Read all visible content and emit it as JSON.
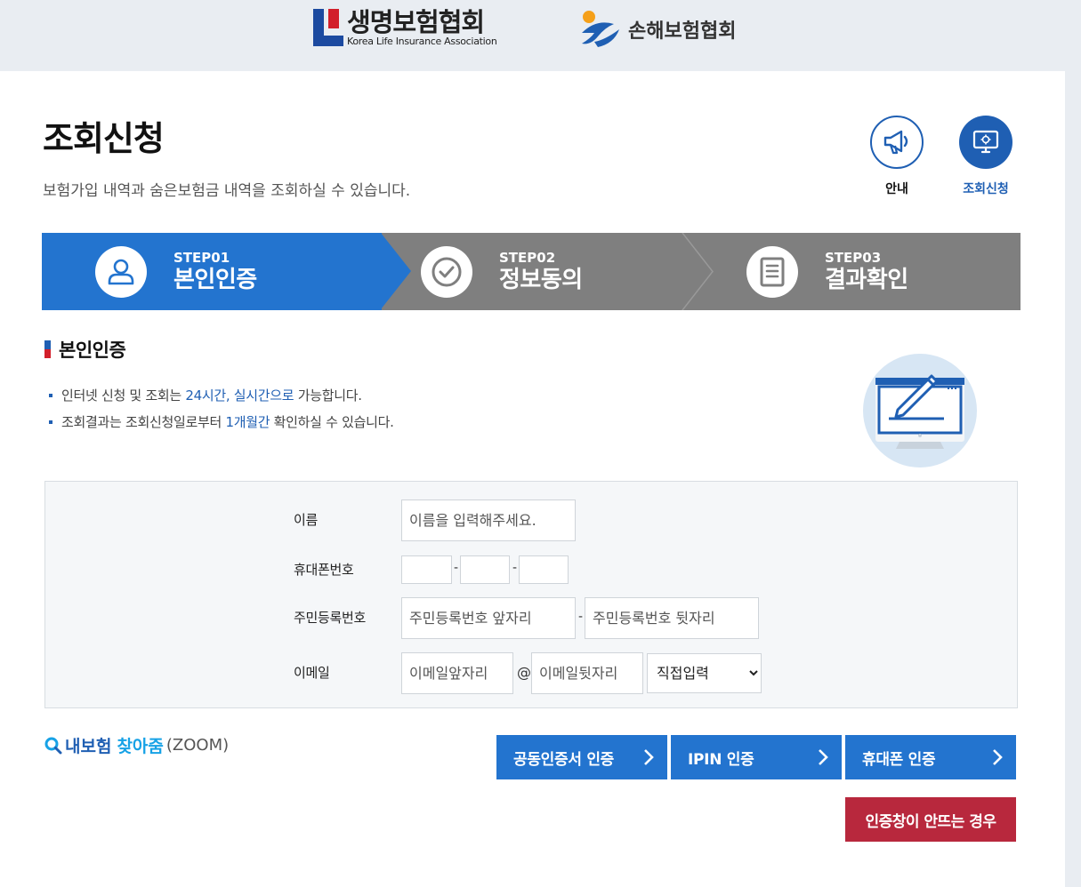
{
  "header": {
    "life_logo_ko": "생명보험협회",
    "life_logo_en": "Korea Life Insurance Association",
    "nonlife_logo_ko": "손해보험협회"
  },
  "page": {
    "title": "조회신청",
    "description": "보험가입 내역과 숨은보험금 내역을 조회하실 수 있습니다."
  },
  "quick_icons": {
    "guide": {
      "label": "안내",
      "icon": "megaphone-icon"
    },
    "apply": {
      "label": "조회신청",
      "icon": "monitor-icon"
    }
  },
  "steps": [
    {
      "num": "STEP01",
      "name": "본인인증",
      "icon": "user-icon",
      "active": true
    },
    {
      "num": "STEP02",
      "name": "정보동의",
      "icon": "check-circle-icon",
      "active": false
    },
    {
      "num": "STEP03",
      "name": "결과확인",
      "icon": "document-icon",
      "active": false
    }
  ],
  "section": {
    "title": "본인인증",
    "notes": [
      {
        "pre": "인터넷 신청 및 조회는 ",
        "hl": "24시간, 실시간으로",
        "post": " 가능합니다."
      },
      {
        "pre": "조회결과는 조회신청일로부터 ",
        "hl": "1개월간",
        "post": " 확인하실 수 있습니다."
      }
    ]
  },
  "form": {
    "name_label": "이름",
    "name_placeholder": "이름을 입력해주세요.",
    "phone_label": "휴대폰번호",
    "phone_sep": "-",
    "rrn_label": "주민등록번호",
    "rrn_front_placeholder": "주민등록번호 앞자리",
    "rrn_back_placeholder": "주민등록번호 뒷자리",
    "rrn_sep": "-",
    "email_label": "이메일",
    "email_front_placeholder": "이메일앞자리",
    "email_at": "@",
    "email_back_placeholder": "이메일뒷자리",
    "email_domain_selected": "직접입력"
  },
  "zoom": {
    "part1": "내보험",
    "part2": "찾아줌",
    "part3": "(ZOOM)"
  },
  "buttons": {
    "cert": "공동인증서 인증",
    "ipin": "IPIN 인증",
    "phone": "휴대폰 인증",
    "help": "인증창이 안뜨는 경우"
  },
  "colors": {
    "primary": "#2374cf",
    "step_inactive": "#7f7f7f",
    "help": "#b8283d",
    "brand_red": "#d21f2b",
    "accent_cyan": "#17a2e6"
  }
}
